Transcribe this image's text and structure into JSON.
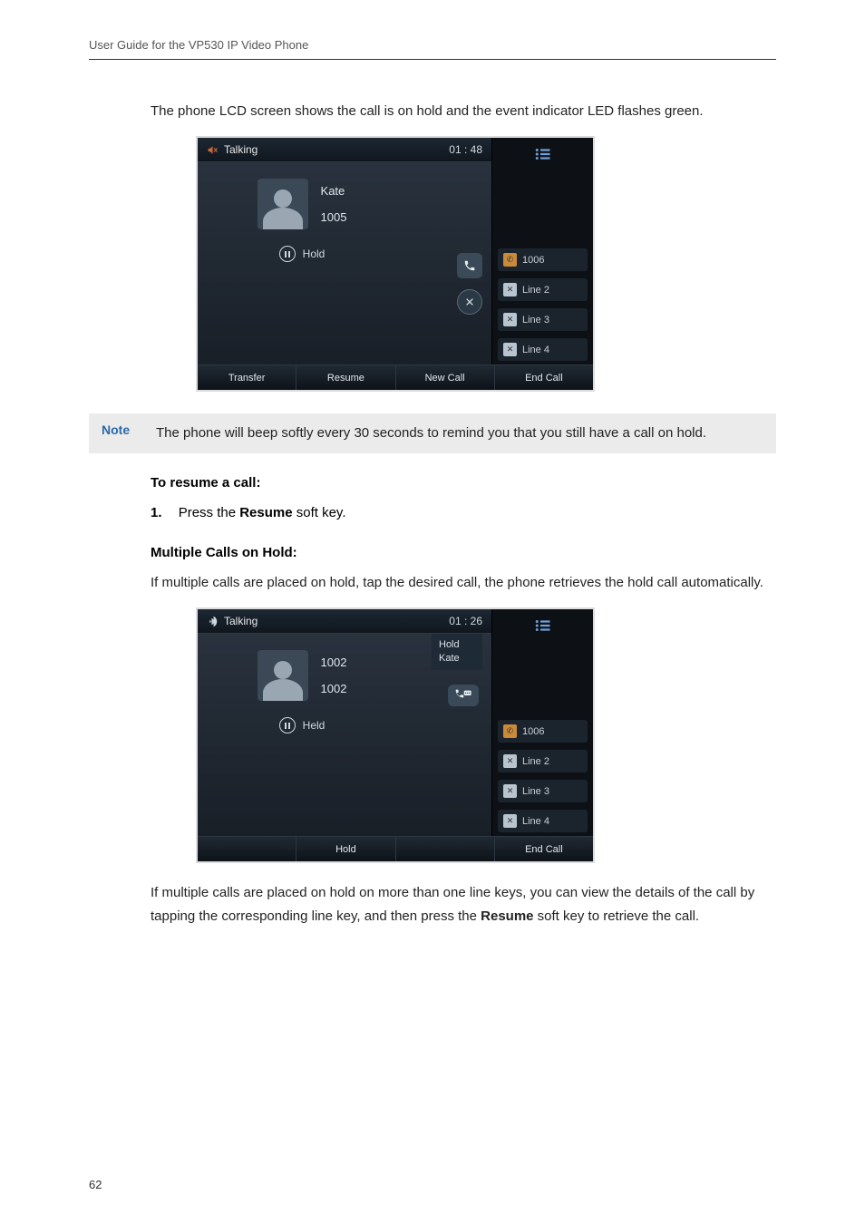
{
  "header": "User Guide for the VP530 IP Video Phone",
  "page_number": "62",
  "intro_para": "The phone LCD screen shows the call is on hold and the event indicator LED flashes green.",
  "fig1": {
    "title": "Talking",
    "clock": "01 : 48",
    "caller_name": "Kate",
    "caller_num": "1005",
    "status": "Hold",
    "lines": [
      "1006",
      "Line 2",
      "Line 3",
      "Line 4"
    ],
    "softkeys": [
      "Transfer",
      "Resume",
      "New Call",
      "End Call"
    ]
  },
  "note": {
    "label": "Note",
    "text": "The phone will beep softly every 30 seconds to remind you that you still have a call on hold."
  },
  "resume": {
    "heading": "To resume a call:",
    "step_num": "1.",
    "step_pre": "Press the ",
    "step_bold": "Resume",
    "step_post": " soft key."
  },
  "multi": {
    "heading": "Multiple Calls on Hold:",
    "para1": "If multiple calls are placed on hold, tap the desired call, the phone retrieves the hold call automatically."
  },
  "fig2": {
    "title": "Talking",
    "clock": "01 : 26",
    "hold_label": "Hold",
    "hold_name": "Kate",
    "caller_name": "1002",
    "caller_num": "1002",
    "status": "Held",
    "lines": [
      "1006",
      "Line 2",
      "Line 3",
      "Line 4"
    ],
    "softkeys": [
      "",
      "Hold",
      "",
      "End Call"
    ]
  },
  "closing_pre": "If multiple calls are placed on hold on more than one line keys, you can view the details of the call by tapping the corresponding line key, and then press the ",
  "closing_bold": "Resume",
  "closing_post": " soft key to retrieve the call."
}
